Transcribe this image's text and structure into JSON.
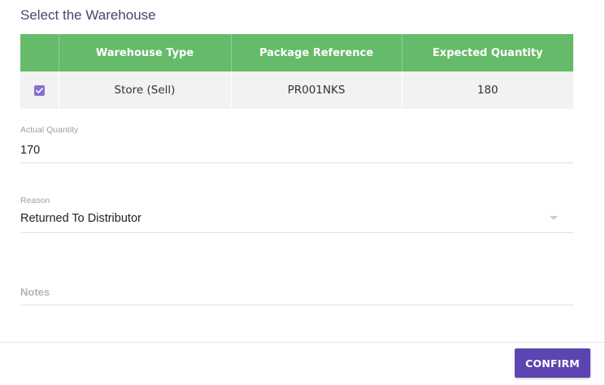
{
  "dialog": {
    "section_title": "Select the Warehouse"
  },
  "table": {
    "columns": [
      "",
      "Warehouse Type",
      "Package Reference",
      "Expected Quantity"
    ],
    "rows": [
      {
        "selected": true,
        "warehouse_type": "Store (Sell)",
        "package_reference": "PR001NKS",
        "expected_quantity": "180"
      }
    ]
  },
  "form": {
    "actual_quantity": {
      "label": "Actual Quantity",
      "value": "170"
    },
    "reason": {
      "label": "Reason",
      "value": "Returned To Distributor"
    },
    "notes": {
      "placeholder": "Notes"
    }
  },
  "actions": {
    "confirm_label": "CONFIRM"
  },
  "colors": {
    "header_green": "#66bb6a",
    "accent_purple": "#5c45b0",
    "checkbox_purple": "#8a6fd6"
  }
}
